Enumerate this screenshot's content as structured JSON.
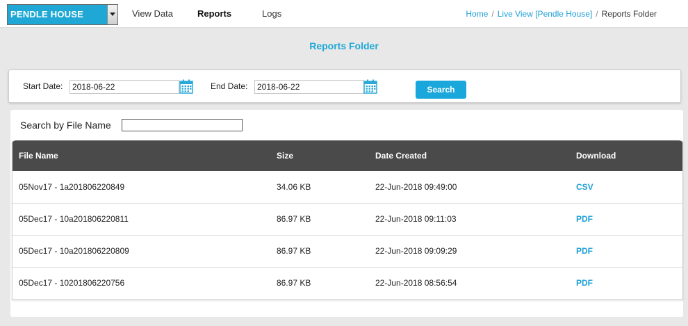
{
  "site_selector": {
    "value": "PENDLE HOUSE"
  },
  "nav": {
    "view_data": "View Data",
    "reports": "Reports",
    "logs": "Logs"
  },
  "breadcrumb": {
    "home": "Home",
    "sep1": "/",
    "live_view": "Live View [Pendle House]",
    "sep2": "/",
    "current": "Reports Folder"
  },
  "page_title": "Reports Folder",
  "filter": {
    "start_label": "Start Date:",
    "start_value": "2018-06-22",
    "end_label": "End Date:",
    "end_value": "2018-06-22",
    "search_label": "Search"
  },
  "file_search": {
    "label": "Search by File Name",
    "value": ""
  },
  "table": {
    "headers": {
      "name": "File Name",
      "size": "Size",
      "date": "Date Created",
      "download": "Download"
    },
    "rows": [
      {
        "name": "05Nov17 - 1a201806220849",
        "size": "34.06 KB",
        "date": "22-Jun-2018 09:49:00",
        "download": "CSV"
      },
      {
        "name": "05Dec17 - 10a201806220811",
        "size": "86.97 KB",
        "date": "22-Jun-2018 09:11:03",
        "download": "PDF"
      },
      {
        "name": "05Dec17 - 10a201806220809",
        "size": "86.97 KB",
        "date": "22-Jun-2018 09:09:29",
        "download": "PDF"
      },
      {
        "name": "05Dec17 - 10201806220756",
        "size": "86.97 KB",
        "date": "22-Jun-2018 08:56:54",
        "download": "PDF"
      }
    ]
  },
  "icons": {
    "calendar": "calendar-icon",
    "dropdown": "chevron-down-icon"
  },
  "colors": {
    "accent": "#1fa8d6",
    "header_bg": "#4a4a4a",
    "page_bg": "#e8e8e8"
  }
}
